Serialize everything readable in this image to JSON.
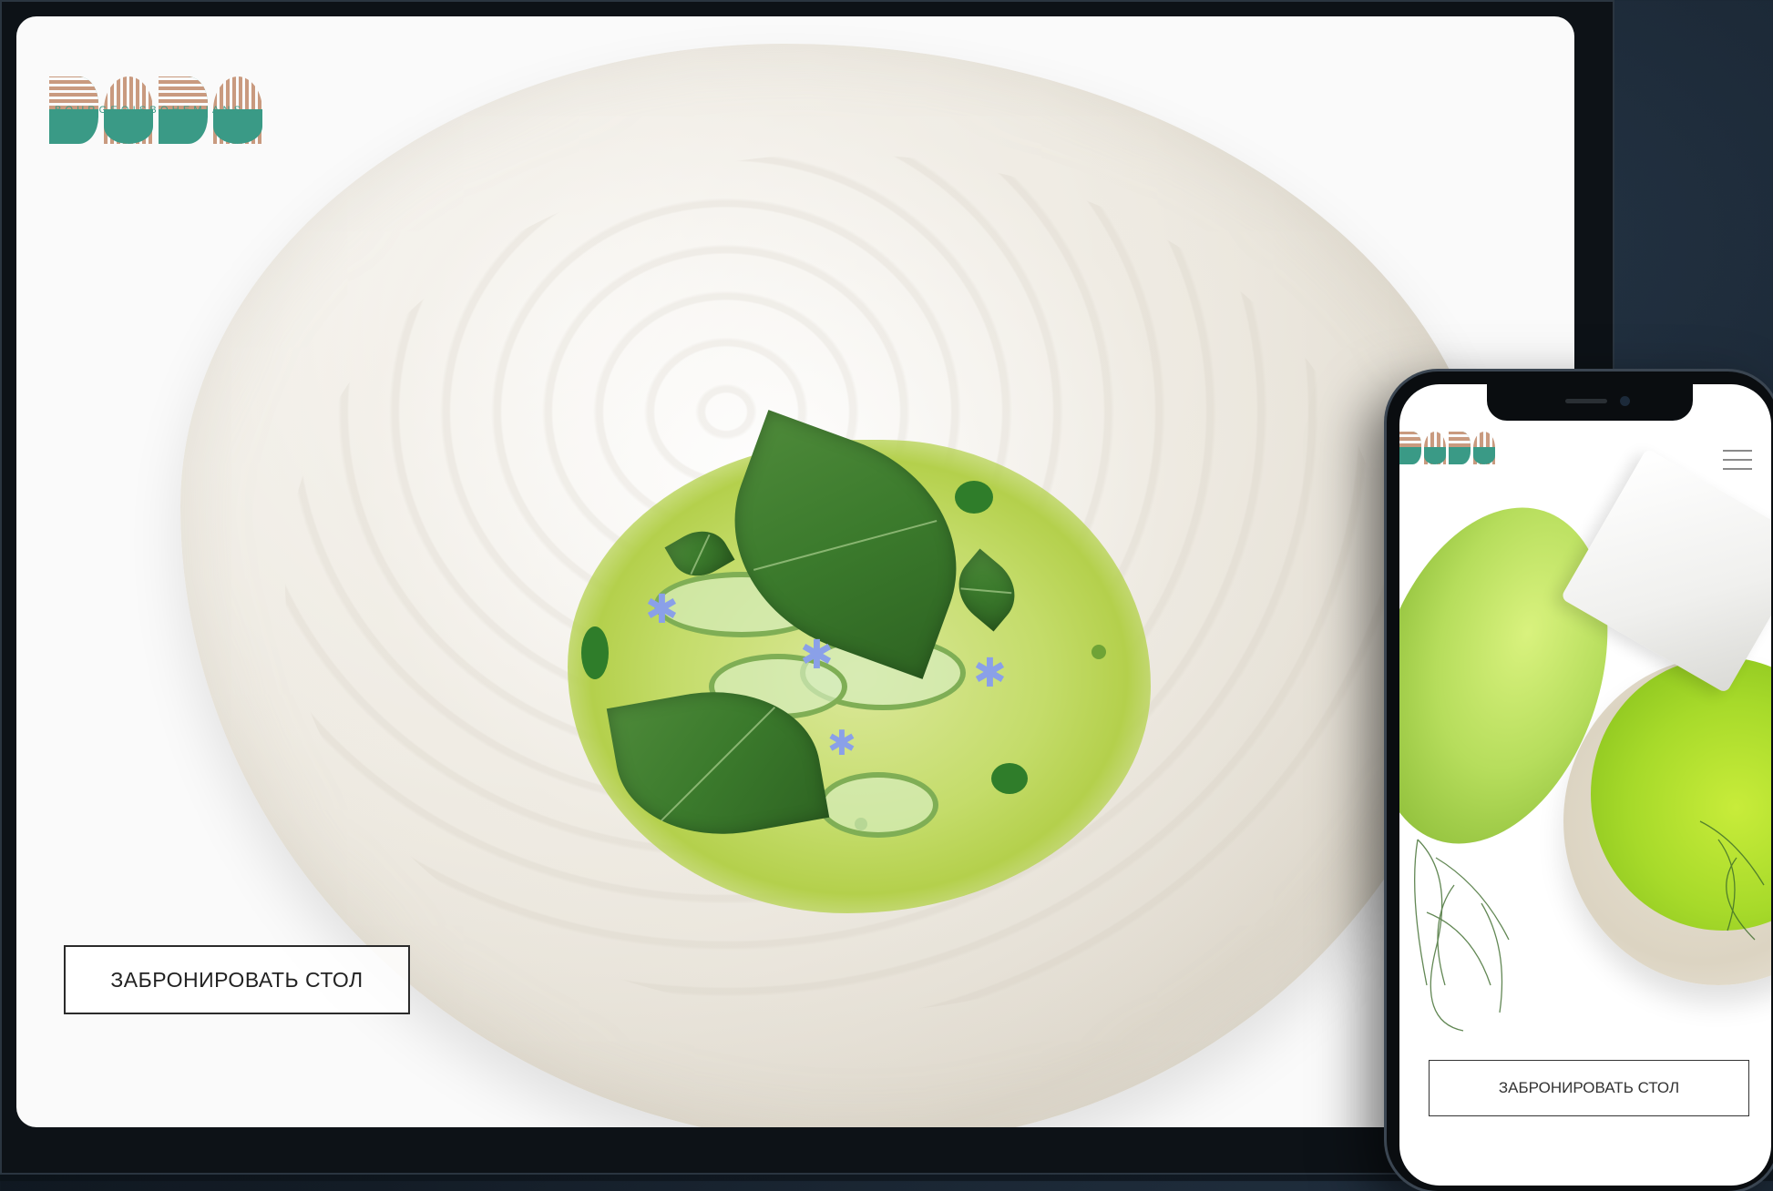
{
  "brand": {
    "logo_text": "BOBO",
    "tagline": "BOURGEOISBOHEMIANS",
    "colors": {
      "teal": "#3a9a86",
      "copper": "#c99a7f"
    }
  },
  "tablet": {
    "reserve_button": "ЗАБРОНИРОВАТЬ СТОЛ",
    "hero_image": "dish-on-white-plate"
  },
  "phone": {
    "reserve_button": "ЗАБРОНИРОВАТЬ СТОЛ",
    "menu_icon": "hamburger-menu-icon",
    "hero_image": "green-dessert"
  }
}
